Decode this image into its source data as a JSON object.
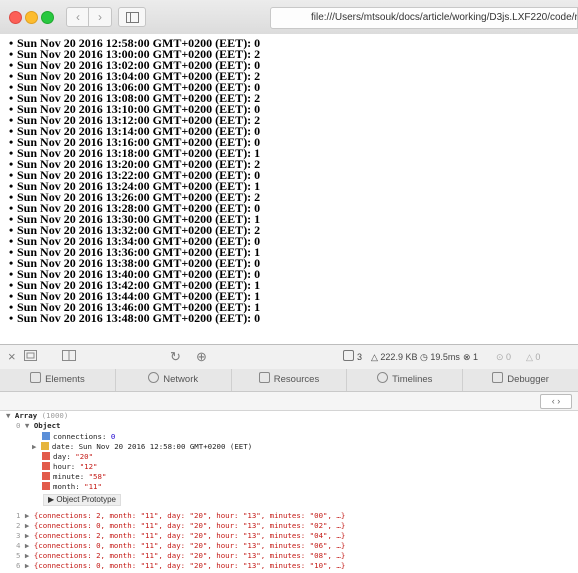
{
  "browser": {
    "url": "file:///Users/mtsouk/docs/article/working/D3js.LXF220/code/readFile.htm",
    "back_glyph": "‹",
    "forward_glyph": "›"
  },
  "page": {
    "items": [
      "Sun Nov 20 2016 12:58:00 GMT+0200 (EET): 0",
      "Sun Nov 20 2016 13:00:00 GMT+0200 (EET): 2",
      "Sun Nov 20 2016 13:02:00 GMT+0200 (EET): 0",
      "Sun Nov 20 2016 13:04:00 GMT+0200 (EET): 2",
      "Sun Nov 20 2016 13:06:00 GMT+0200 (EET): 0",
      "Sun Nov 20 2016 13:08:00 GMT+0200 (EET): 2",
      "Sun Nov 20 2016 13:10:00 GMT+0200 (EET): 0",
      "Sun Nov 20 2016 13:12:00 GMT+0200 (EET): 2",
      "Sun Nov 20 2016 13:14:00 GMT+0200 (EET): 0",
      "Sun Nov 20 2016 13:16:00 GMT+0200 (EET): 0",
      "Sun Nov 20 2016 13:18:00 GMT+0200 (EET): 1",
      "Sun Nov 20 2016 13:20:00 GMT+0200 (EET): 2",
      "Sun Nov 20 2016 13:22:00 GMT+0200 (EET): 0",
      "Sun Nov 20 2016 13:24:00 GMT+0200 (EET): 1",
      "Sun Nov 20 2016 13:26:00 GMT+0200 (EET): 2",
      "Sun Nov 20 2016 13:28:00 GMT+0200 (EET): 0",
      "Sun Nov 20 2016 13:30:00 GMT+0200 (EET): 1",
      "Sun Nov 20 2016 13:32:00 GMT+0200 (EET): 2",
      "Sun Nov 20 2016 13:34:00 GMT+0200 (EET): 0",
      "Sun Nov 20 2016 13:36:00 GMT+0200 (EET): 1",
      "Sun Nov 20 2016 13:38:00 GMT+0200 (EET): 0",
      "Sun Nov 20 2016 13:40:00 GMT+0200 (EET): 0",
      "Sun Nov 20 2016 13:42:00 GMT+0200 (EET): 1",
      "Sun Nov 20 2016 13:44:00 GMT+0200 (EET): 1",
      "Sun Nov 20 2016 13:46:00 GMT+0200 (EET): 1",
      "Sun Nov 20 2016 13:48:00 GMT+0200 (EET): 0"
    ]
  },
  "inspector": {
    "close_glyph": "×",
    "reload_glyph": "↻",
    "download_glyph": "⊕",
    "stats": {
      "resources_count": "3",
      "size": "222.9 KB",
      "time": "19.5ms",
      "errors": "1",
      "warnings": "0",
      "logs": "0"
    },
    "tabs": [
      "Elements",
      "Network",
      "Resources",
      "Timelines",
      "Debugger"
    ],
    "nav_glyphs": "‹ ›"
  },
  "console": {
    "array_label": "Array",
    "array_count": "(1000)",
    "index0": "0",
    "object_label": "Object",
    "props": {
      "connections_key": "connections:",
      "connections_val": "0",
      "date_key": "date:",
      "date_val": "Sun Nov 20 2016 12:58:00 GMT+0200 (EET)",
      "day_key": "day:",
      "day_val": "\"20\"",
      "hour_key": "hour:",
      "hour_val": "\"12\"",
      "minute_key": "minute:",
      "minute_val": "\"58\"",
      "month_key": "month:",
      "month_val": "\"11\""
    },
    "proto_label": "Object Prototype",
    "rows": [
      {
        "idx": "1",
        "text": "{connections: 2, month: \"11\", day: \"20\", hour: \"13\", minutes: \"00\", …}"
      },
      {
        "idx": "2",
        "text": "{connections: 0, month: \"11\", day: \"20\", hour: \"13\", minutes: \"02\", …}"
      },
      {
        "idx": "3",
        "text": "{connections: 2, month: \"11\", day: \"20\", hour: \"13\", minutes: \"04\", …}"
      },
      {
        "idx": "4",
        "text": "{connections: 0, month: \"11\", day: \"20\", hour: \"13\", minutes: \"06\", …}"
      },
      {
        "idx": "5",
        "text": "{connections: 2, month: \"11\", day: \"20\", hour: \"13\", minutes: \"08\", …}"
      },
      {
        "idx": "6",
        "text": "{connections: 0, month: \"11\", day: \"20\", hour: \"13\", minutes: \"10\", …}"
      }
    ]
  }
}
